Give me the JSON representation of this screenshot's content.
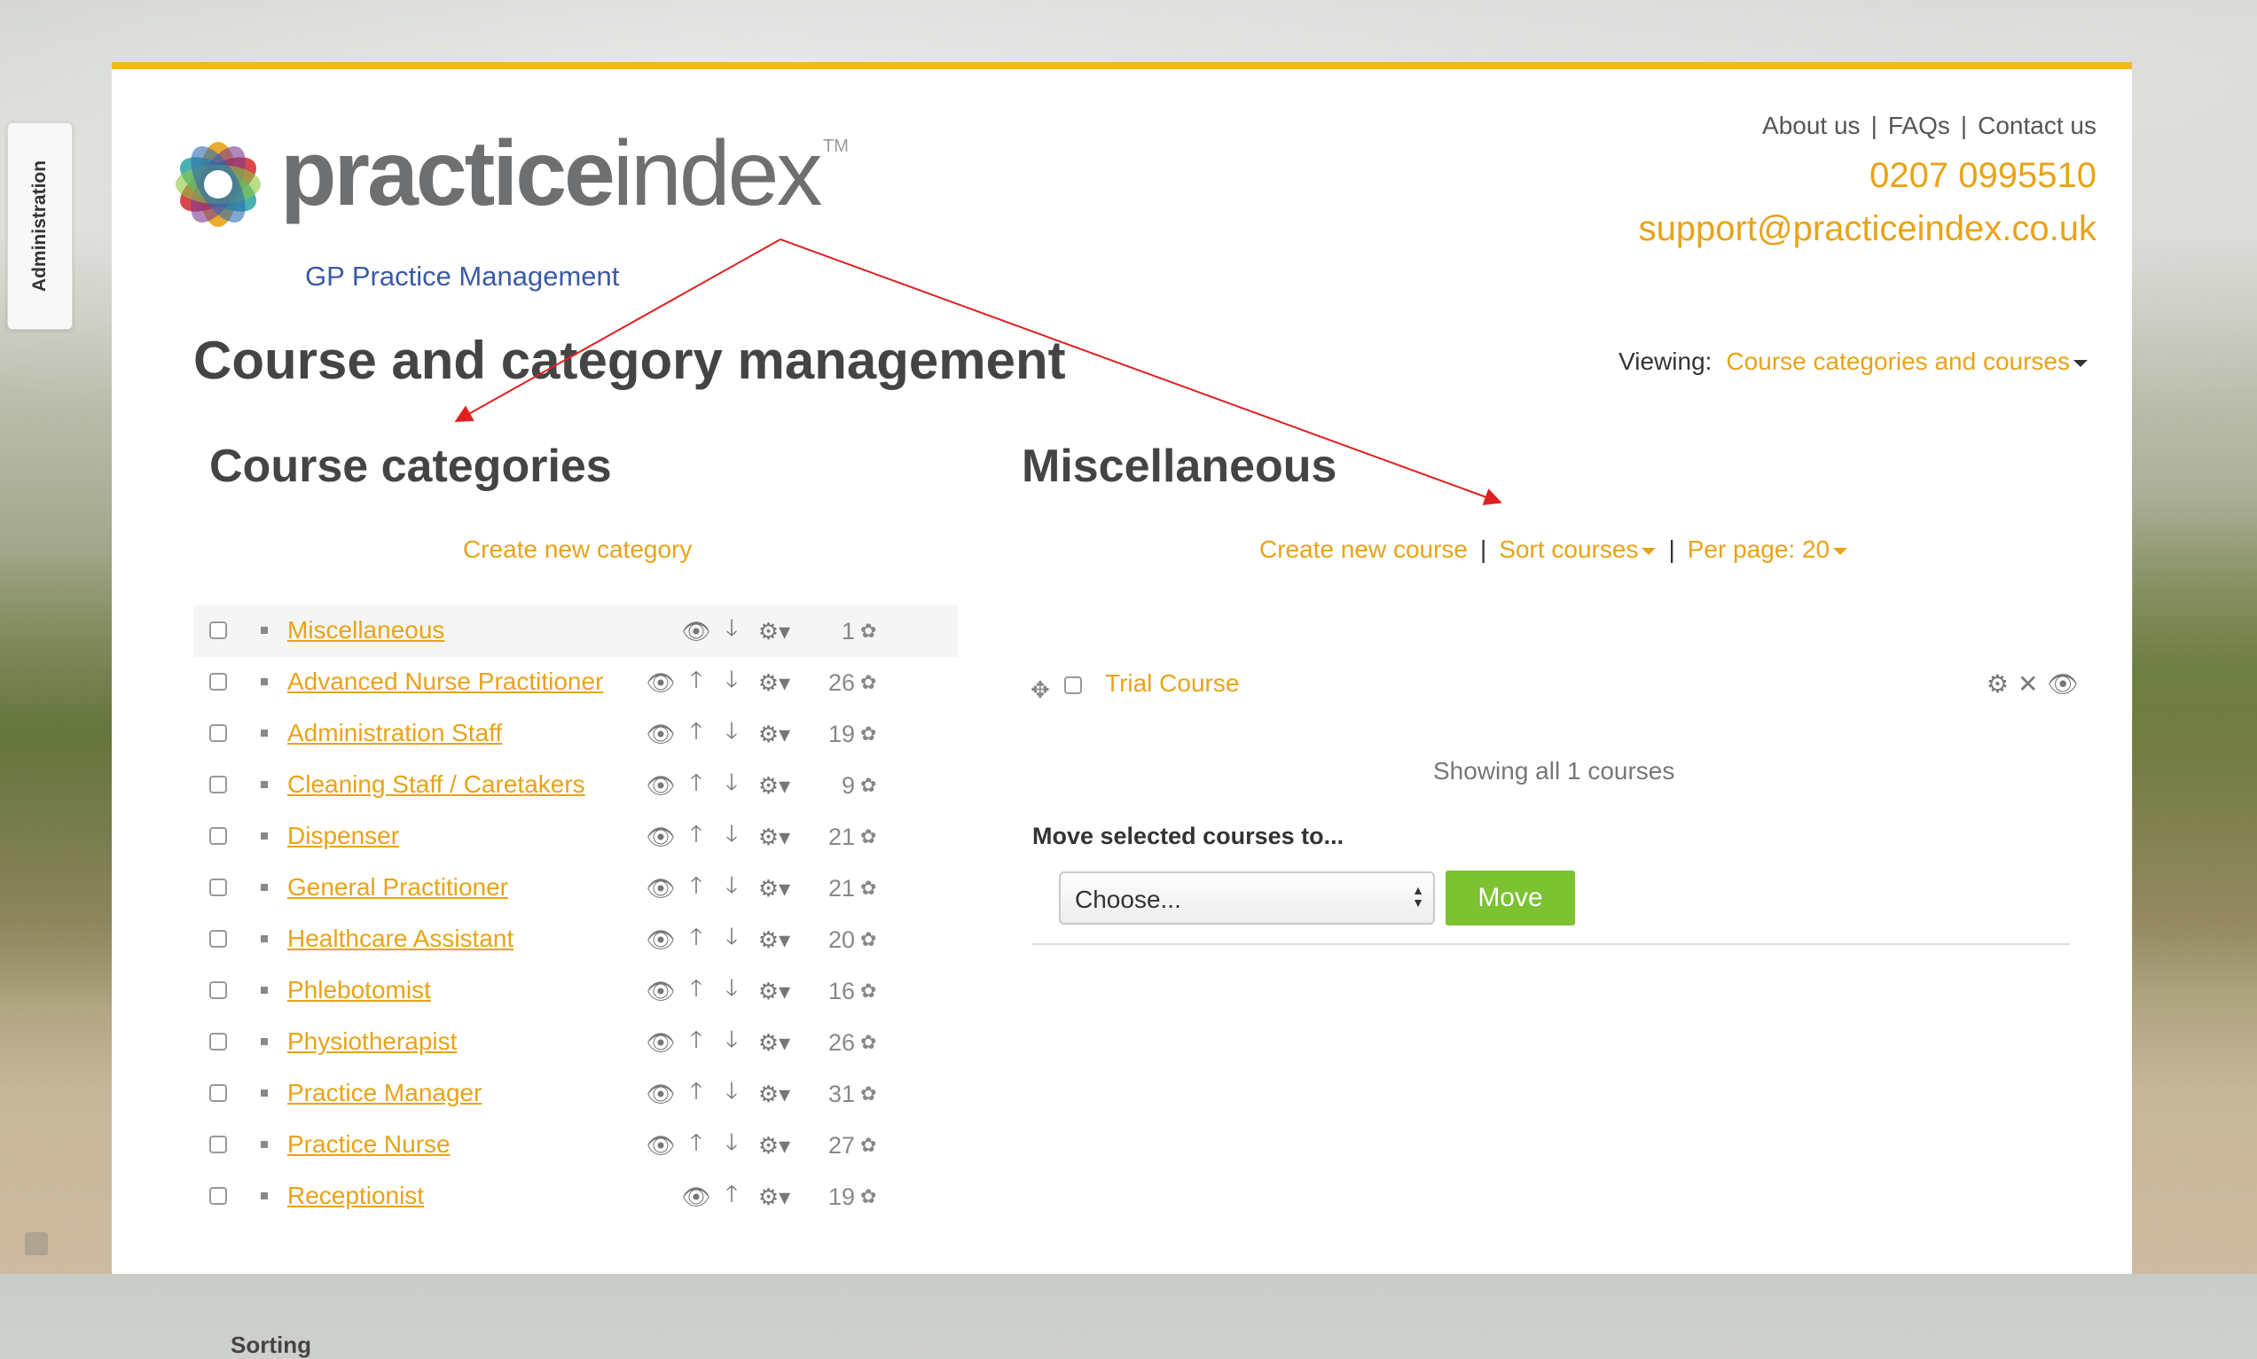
{
  "admin_tab": {
    "label": "Administration"
  },
  "logo": {
    "word_bold": "practice",
    "word_light": "index",
    "tm": "TM",
    "subtitle": "GP Practice Management"
  },
  "header": {
    "links": [
      "About us",
      "FAQs",
      "Contact us"
    ],
    "phone": "0207 0995510",
    "email": "support@practiceindex.co.uk"
  },
  "page_title": "Course and category management",
  "viewing": {
    "label": "Viewing:",
    "value": "Course categories and courses"
  },
  "categories": {
    "title": "Course categories",
    "create_label": "Create new category",
    "items": [
      {
        "name": "Miscellaneous",
        "count": "1",
        "up": false
      },
      {
        "name": "Advanced Nurse Practitioner",
        "count": "26",
        "up": true
      },
      {
        "name": "Administration Staff",
        "count": "19",
        "up": true
      },
      {
        "name": "Cleaning Staff / Caretakers",
        "count": "9",
        "up": true
      },
      {
        "name": "Dispenser",
        "count": "21",
        "up": true
      },
      {
        "name": "General Practitioner",
        "count": "21",
        "up": true
      },
      {
        "name": "Healthcare Assistant",
        "count": "20",
        "up": true
      },
      {
        "name": "Phlebotomist",
        "count": "16",
        "up": true
      },
      {
        "name": "Physiotherapist",
        "count": "26",
        "up": true
      },
      {
        "name": "Practice Manager",
        "count": "31",
        "up": true
      },
      {
        "name": "Practice Nurse",
        "count": "27",
        "up": true
      },
      {
        "name": "Receptionist",
        "count": "19",
        "up": true,
        "down": false
      }
    ],
    "sorting_label": "Sorting"
  },
  "courses": {
    "title": "Miscellaneous",
    "create_label": "Create new course",
    "sort_label": "Sort courses",
    "per_page_label": "Per page: 20",
    "items": [
      {
        "name": "Trial Course"
      }
    ],
    "showing": "Showing all 1 courses",
    "move_label": "Move selected courses to...",
    "select_value": "Choose...",
    "move_button": "Move"
  },
  "colors": {
    "accent": "#e8a317",
    "top_bar": "#f3b821",
    "move_button": "#7cc231",
    "annotation": "#e02020"
  }
}
